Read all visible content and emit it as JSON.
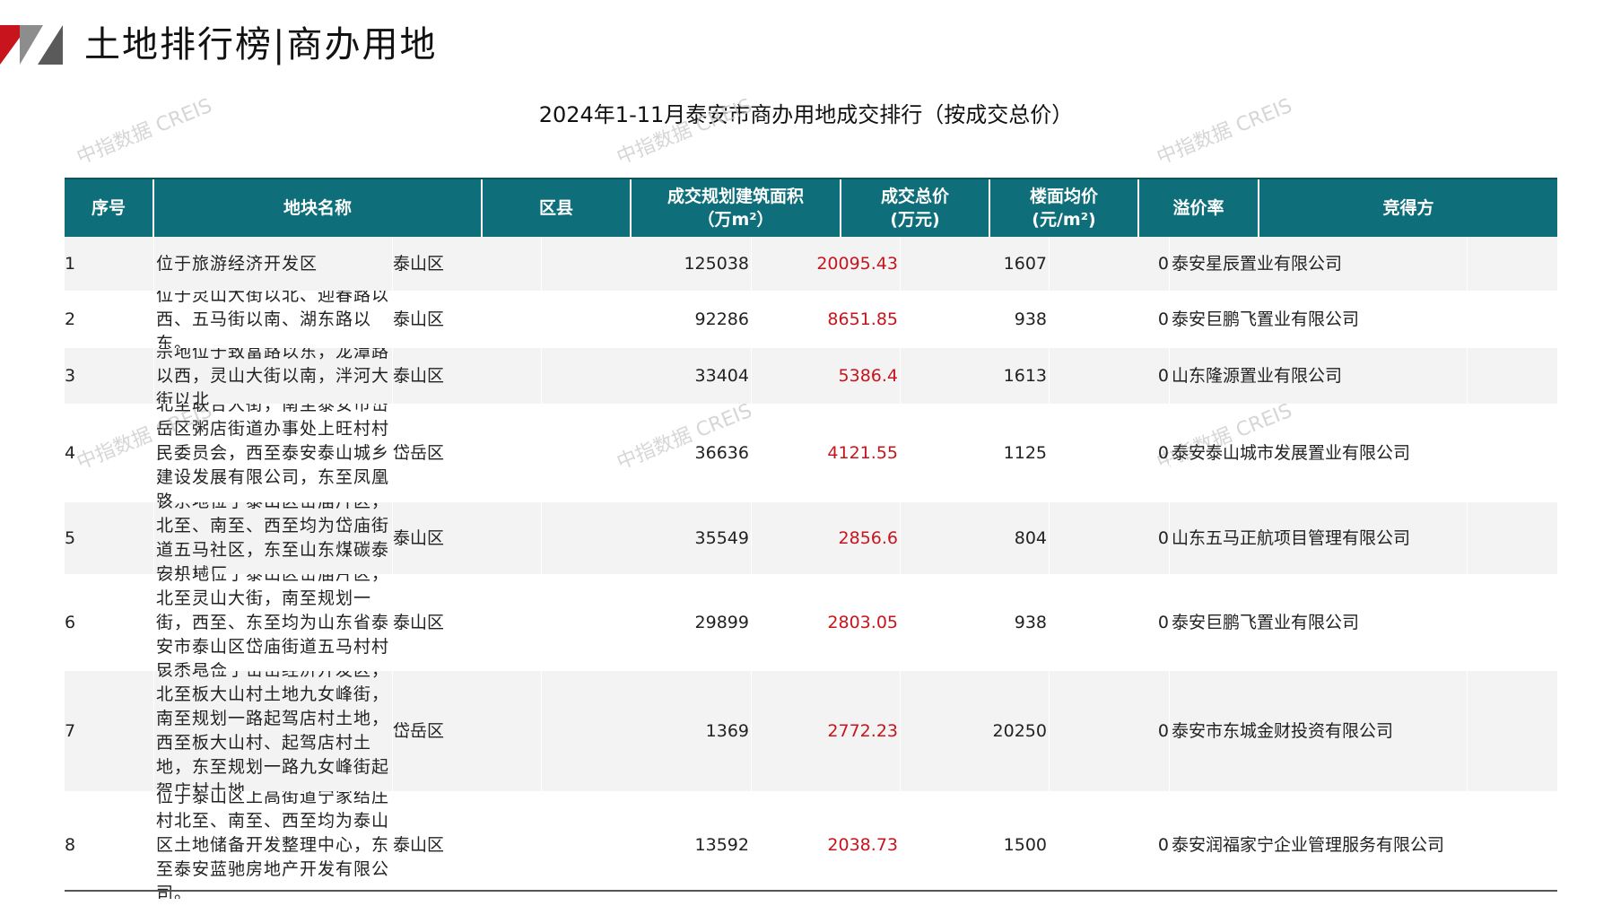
{
  "header": {
    "title": "土地排行榜|商办用地"
  },
  "table": {
    "title": "2024年1-11月泰安市商办用地成交排行（按成交总价）",
    "columns": {
      "seq": "序号",
      "name": "地块名称",
      "district": "区县",
      "area_line1": "成交规划建筑面积",
      "area_line2": "（万m²）",
      "total_line1": "成交总价",
      "total_line2": "(万元)",
      "avg_line1": "楼面均价",
      "avg_line2": "(元/m²)",
      "premium": "溢价率",
      "winner": "竞得方"
    },
    "rows": [
      {
        "seq": "1",
        "name": "位于旅游经济开发区",
        "district": "泰山区",
        "area": "125038",
        "total": "20095.43",
        "avg": "1607",
        "premium": "0",
        "winner": "泰安星辰置业有限公司"
      },
      {
        "seq": "2",
        "name": "位于灵山大街以北、迎春路以西、五马街以南、湖东路以东。",
        "district": "泰山区",
        "area": "92286",
        "total": "8651.85",
        "avg": "938",
        "premium": "0",
        "winner": "泰安巨鹏飞置业有限公司"
      },
      {
        "seq": "3",
        "name": "宗地位于致富路以东，龙潭路以西，灵山大街以南，泮河大街以北",
        "district": "泰山区",
        "area": "33404",
        "total": "5386.4",
        "avg": "1613",
        "premium": "0",
        "winner": "山东隆源置业有限公司"
      },
      {
        "seq": "4",
        "name": "北至联合大街，南至泰安市岱岳区粥店街道办事处上旺村村民委员会，西至泰安泰山城乡建设发展有限公司，东至凤凰路.",
        "district": "岱岳区",
        "area": "36636",
        "total": "4121.55",
        "avg": "1125",
        "premium": "0",
        "winner": "泰安泰山城市发展置业有限公司"
      },
      {
        "seq": "5",
        "name": "该宗地位于泰山区岱庙片区，北至、南至、西至均为岱庙街道五马社区，东至山东煤碳泰安机械厂",
        "district": "泰山区",
        "area": "35549",
        "total": "2856.6",
        "avg": "804",
        "premium": "0",
        "winner": "山东五马正航项目管理有限公司"
      },
      {
        "seq": "6",
        "name": "该宗地位于泰山区岱庙片区，北至灵山大街，南至规划一街，西至、东至均为山东省泰安市泰山区岱庙街道五马村村民委员会。",
        "district": "泰山区",
        "area": "29899",
        "total": "2803.05",
        "avg": "938",
        "premium": "0",
        "winner": "泰安巨鹏飞置业有限公司"
      },
      {
        "seq": "7",
        "name": "该宗地位于岱岳经济开发区，北至板大山村土地九女峰街，南至规划一路起驾店村土地，西至板大山村、起驾店村土地，东至规划一路九女峰街起驾店村土地。",
        "district": "岱岳区",
        "area": "1369",
        "total": "2772.23",
        "avg": "20250",
        "premium": "0",
        "winner": "泰安市东城金财投资有限公司"
      },
      {
        "seq": "8",
        "name": "位于泰山区上高街道宁家结庄村北至、南至、西至均为泰山区土地储备开发整理中心，东至泰安蓝驰房地产开发有限公司。",
        "district": "泰山区",
        "area": "13592",
        "total": "2038.73",
        "avg": "1500",
        "premium": "0",
        "winner": "泰安润福家宁企业管理服务有限公司"
      }
    ]
  },
  "watermark": {
    "text": "中指数据 CREIS"
  },
  "colors": {
    "header_bg": "#0e6e7a",
    "accent_red": "#c8141c"
  }
}
